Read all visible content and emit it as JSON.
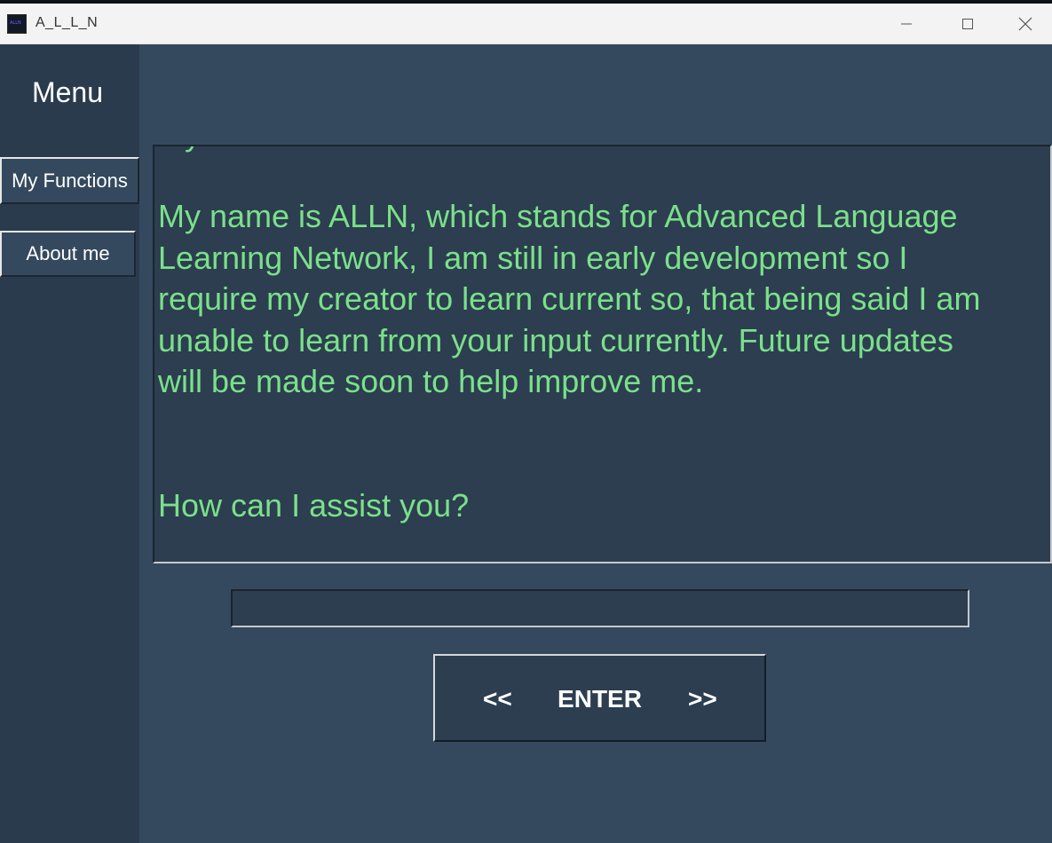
{
  "window": {
    "title": "A_L_L_N",
    "controls": {
      "minimize_icon": "minimize-icon",
      "maximize_icon": "maximize-icon",
      "close_icon": "close-icon"
    }
  },
  "sidebar": {
    "title": "Menu",
    "buttons": [
      {
        "label": "My Functions"
      },
      {
        "label": "About me"
      }
    ]
  },
  "output": {
    "clipped_line": "My name is ALLN",
    "message": "My name is ALLN, which stands for Advanced Language Learning Network, I am still in early development so I require my creator to learn current so, that being said I am unable to learn from your input currently. Future updates will be made soon to help improve me.",
    "question": "How can I assist you?"
  },
  "input": {
    "value": "",
    "placeholder": ""
  },
  "enter_button": {
    "left": "<<",
    "label": "ENTER",
    "right": ">>"
  },
  "colors": {
    "background": "#34495e",
    "sidebar": "#2b3b4e",
    "panel": "#2c3e50",
    "text_green": "#7be08a",
    "text_white": "#ffffff"
  }
}
